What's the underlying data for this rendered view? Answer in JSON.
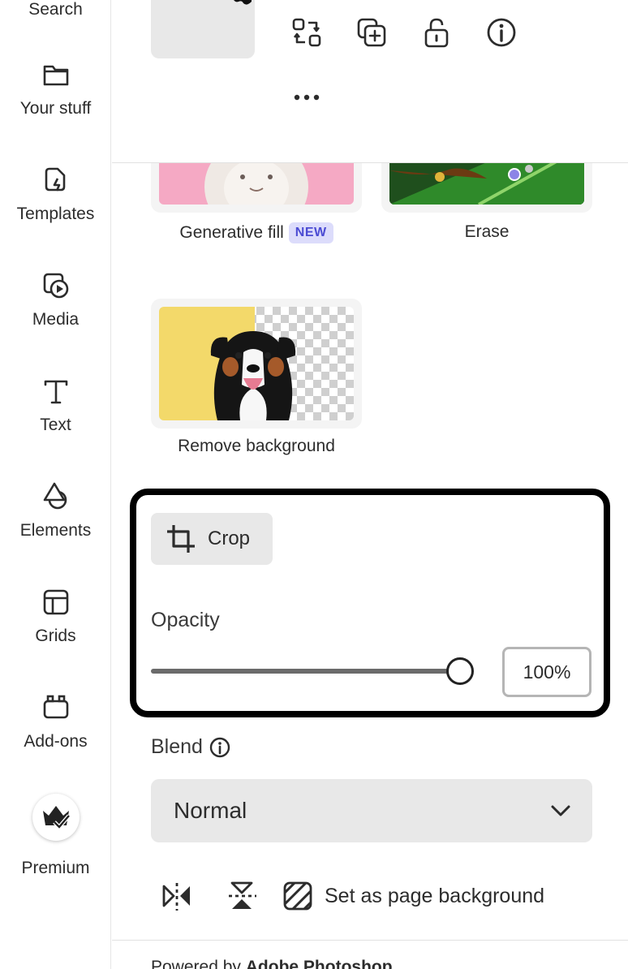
{
  "rail": {
    "items": [
      {
        "label": "Search",
        "icon": "search-icon"
      },
      {
        "label": "Your stuff",
        "icon": "folder-icon"
      },
      {
        "label": "Templates",
        "icon": "templates-icon"
      },
      {
        "label": "Media",
        "icon": "media-icon"
      },
      {
        "label": "Text",
        "icon": "text-icon"
      },
      {
        "label": "Elements",
        "icon": "elements-icon"
      },
      {
        "label": "Grids",
        "icon": "grids-icon"
      },
      {
        "label": "Add-ons",
        "icon": "addons-icon"
      },
      {
        "label": "Premium",
        "icon": "crown-icon"
      }
    ]
  },
  "toolbar": {
    "icons": [
      "replace-icon",
      "duplicate-icon",
      "unlock-icon",
      "info-icon",
      "more-icon"
    ]
  },
  "quick_actions": {
    "generative_fill": {
      "label": "Generative fill",
      "badge": "NEW"
    },
    "erase": {
      "label": "Erase"
    },
    "remove_background": {
      "label": "Remove background"
    }
  },
  "crop": {
    "label": "Crop"
  },
  "opacity": {
    "label": "Opacity",
    "value_text": "100%",
    "value": 1.0
  },
  "blend": {
    "label": "Blend",
    "selected": "Normal"
  },
  "actions": {
    "set_page_background": "Set as page background"
  },
  "footer": {
    "powered_prefix": "Powered by",
    "powered_brand": "Adobe Photoshop"
  },
  "colors": {
    "accent_badge_bg": "#dcdcfb",
    "accent_badge_text": "#4b4bd3",
    "panel_button_bg": "#e8e8e8",
    "focus_border": "#000000"
  }
}
